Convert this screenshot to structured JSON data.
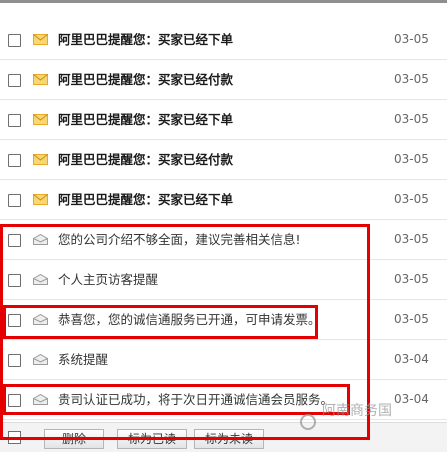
{
  "messages": [
    {
      "subject": "阿里巴巴提醒您：买家已经下单",
      "date": "03-05",
      "state": "unread"
    },
    {
      "subject": "阿里巴巴提醒您：买家已经付款",
      "date": "03-05",
      "state": "unread"
    },
    {
      "subject": "阿里巴巴提醒您：买家已经下单",
      "date": "03-05",
      "state": "unread"
    },
    {
      "subject": "阿里巴巴提醒您：买家已经付款",
      "date": "03-05",
      "state": "unread"
    },
    {
      "subject": "阿里巴巴提醒您：买家已经下单",
      "date": "03-05",
      "state": "unread"
    },
    {
      "subject": "您的公司介绍不够全面，建议完善相关信息!",
      "date": "03-05",
      "state": "read"
    },
    {
      "subject": "个人主页访客提醒",
      "date": "03-05",
      "state": "read"
    },
    {
      "subject": "恭喜您，您的诚信通服务已开通，可申请发票。",
      "date": "03-05",
      "state": "read"
    },
    {
      "subject": "系统提醒",
      "date": "03-04",
      "state": "read"
    },
    {
      "subject": "贵司认证已成功，将于次日开通诚信通会员服务。",
      "date": "03-04",
      "state": "read"
    }
  ],
  "toolbar": {
    "delete_label": "删除",
    "mark_read_label": "标为已读",
    "mark_unread_label": "标为未读"
  },
  "colors": {
    "highlight": "#e40000",
    "unread_envelope": "#e9a927",
    "read_envelope": "#9a9a9a"
  },
  "icons": {
    "unread": "envelope-closed-icon",
    "read": "envelope-open-icon"
  },
  "watermark": {
    "text": "阿南商务国"
  }
}
